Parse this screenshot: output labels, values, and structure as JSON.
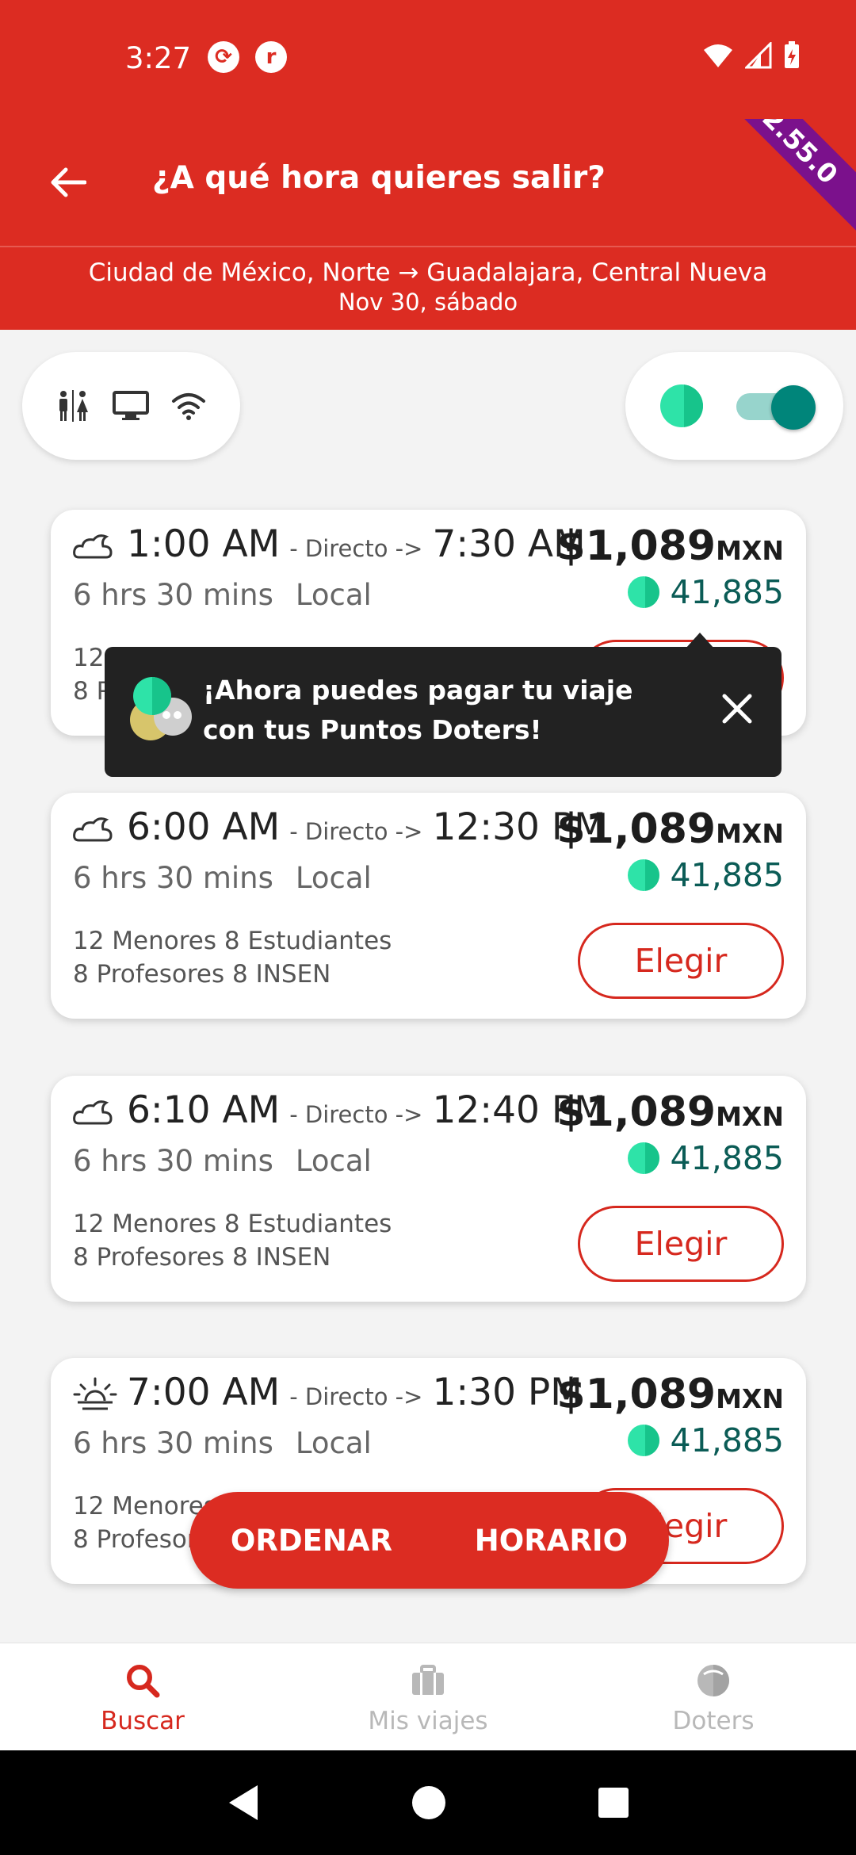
{
  "status_bar": {
    "time": "3:27",
    "app_icons": [
      "sync-icon",
      "r-app-icon"
    ]
  },
  "header": {
    "title": "¿A qué hora quieres salir?",
    "version": "2.55.0",
    "route": "Ciudad de México, Norte → Guadalajara, Central Nueva",
    "date": "Nov 30, sábado"
  },
  "filters": {
    "amenity_icons": [
      "restroom-icon",
      "screen-icon",
      "wifi-icon"
    ],
    "doters_toggle_on": true
  },
  "tooltip": {
    "text": "¡Ahora puedes pagar tu viaje con tus Puntos Doters!"
  },
  "trips": [
    {
      "weather": "cloud-moon-icon",
      "departure": "1:00 AM",
      "direct_label": "- Directo ->",
      "arrival": "7:30 AM",
      "duration": "6 hrs 30 mins",
      "service": "Local",
      "discounts_line1": "12 Menores 8 Estudiantes",
      "discounts_line2": "8 Profesores 8 INSEN",
      "price": "$1,089",
      "currency": "MXN",
      "points": "41,885",
      "button": "Elegir"
    },
    {
      "weather": "cloud-moon-icon",
      "departure": "6:00 AM",
      "direct_label": "- Directo ->",
      "arrival": "12:30 PM",
      "duration": "6 hrs 30 mins",
      "service": "Local",
      "discounts_line1": "12 Menores 8 Estudiantes",
      "discounts_line2": "8 Profesores 8 INSEN",
      "price": "$1,089",
      "currency": "MXN",
      "points": "41,885",
      "button": "Elegir"
    },
    {
      "weather": "cloud-moon-icon",
      "departure": "6:10 AM",
      "direct_label": "- Directo ->",
      "arrival": "12:40 PM",
      "duration": "6 hrs 30 mins",
      "service": "Local",
      "discounts_line1": "12 Menores 8 Estudiantes",
      "discounts_line2": "8 Profesores 8 INSEN",
      "price": "$1,089",
      "currency": "MXN",
      "points": "41,885",
      "button": "Elegir"
    },
    {
      "weather": "sunrise-icon",
      "departure": "7:00 AM",
      "direct_label": "- Directo ->",
      "arrival": "1:30 PM",
      "duration": "6 hrs 30 mins",
      "service": "Local",
      "discounts_line1": "12 Menores 8 Estudiantes",
      "discounts_line2": "8 Profesores 8 INSEN",
      "price": "$1,089",
      "currency": "MXN",
      "points": "41,885",
      "button": "Elegir"
    }
  ],
  "sort_bar": {
    "order": "ORDENAR",
    "schedule": "HORARIO"
  },
  "bottom_nav": [
    {
      "label": "Buscar",
      "icon": "search-icon",
      "active": true
    },
    {
      "label": "Mis viajes",
      "icon": "briefcase-icon",
      "active": false
    },
    {
      "label": "Doters",
      "icon": "doters-icon",
      "active": false
    }
  ],
  "colors": {
    "brand": "#dc2c22",
    "doters_green": "#2ee3a8",
    "toggle_teal": "#00857a",
    "version_purple": "#7b118c"
  }
}
